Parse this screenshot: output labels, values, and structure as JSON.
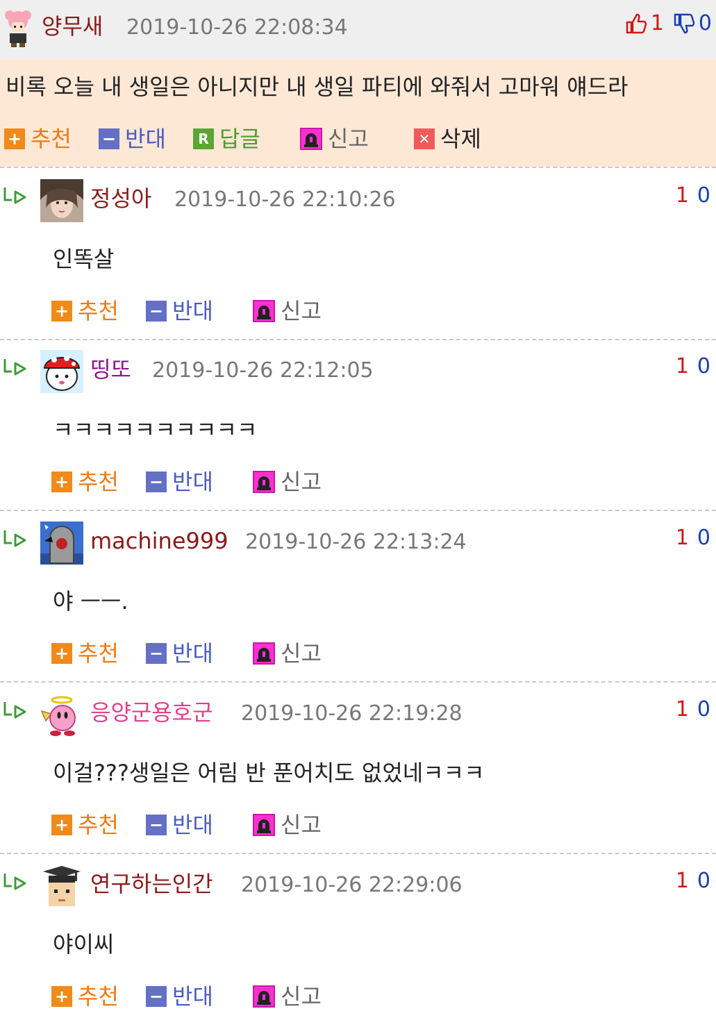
{
  "main_comment": {
    "author": "양무새",
    "author_color": "#8b1a1a",
    "date": "2019-10-26 22:08:34",
    "upvotes": "1",
    "downvotes": "0",
    "text": "비록 오늘 내 생일은 아니지만 내 생일 파티에 와줘서 고마워 얘드라",
    "actions": {
      "recommend": "추천",
      "oppose": "반대",
      "reply": "답글",
      "report": "신고",
      "delete": "삭제"
    },
    "icons": {
      "recommend": "plus-icon",
      "oppose": "minus-icon",
      "reply": "reply-r-icon",
      "report": "siren-icon",
      "delete": "x-icon",
      "upvote": "thumbs-up-icon",
      "downvote": "thumbs-down-icon"
    }
  },
  "replies": [
    {
      "author": "정성아",
      "author_color": "#8b1a1a",
      "date": "2019-10-26 22:10:26",
      "upvotes": "1",
      "downvotes": "0",
      "text": "인똑살"
    },
    {
      "author": "띵또",
      "author_color": "#8a1a8a",
      "date": "2019-10-26 22:12:05",
      "upvotes": "1",
      "downvotes": "0",
      "text": "ㅋㅋㅋㅋㅋㅋㅋㅋㅋㅋ"
    },
    {
      "author": "machine999",
      "author_color": "#8b1a1a",
      "date": "2019-10-26 22:13:24",
      "upvotes": "1",
      "downvotes": "0",
      "text": "야 ㅡㅡ."
    },
    {
      "author": "응양군용호군",
      "author_color": "#e0408a",
      "date": "2019-10-26 22:19:28",
      "upvotes": "1",
      "downvotes": "0",
      "text": "이걸???생일은 어림 반 푼어치도 없었네ㅋㅋㅋ"
    },
    {
      "author": "연구하는인간",
      "author_color": "#8b1a1a",
      "date": "2019-10-26 22:29:06",
      "upvotes": "1",
      "downvotes": "0",
      "text": "야이씨"
    }
  ],
  "reply_actions": {
    "recommend": "추천",
    "oppose": "반대",
    "report": "신고"
  },
  "colors": {
    "upvote": "#d01818",
    "downvote": "#1a3fb0",
    "recommend": "#ee7a10",
    "oppose": "#4a5cc0",
    "reply": "#4e9a2c",
    "header_bg": "#efefef",
    "body_bg": "#fde8d6"
  }
}
